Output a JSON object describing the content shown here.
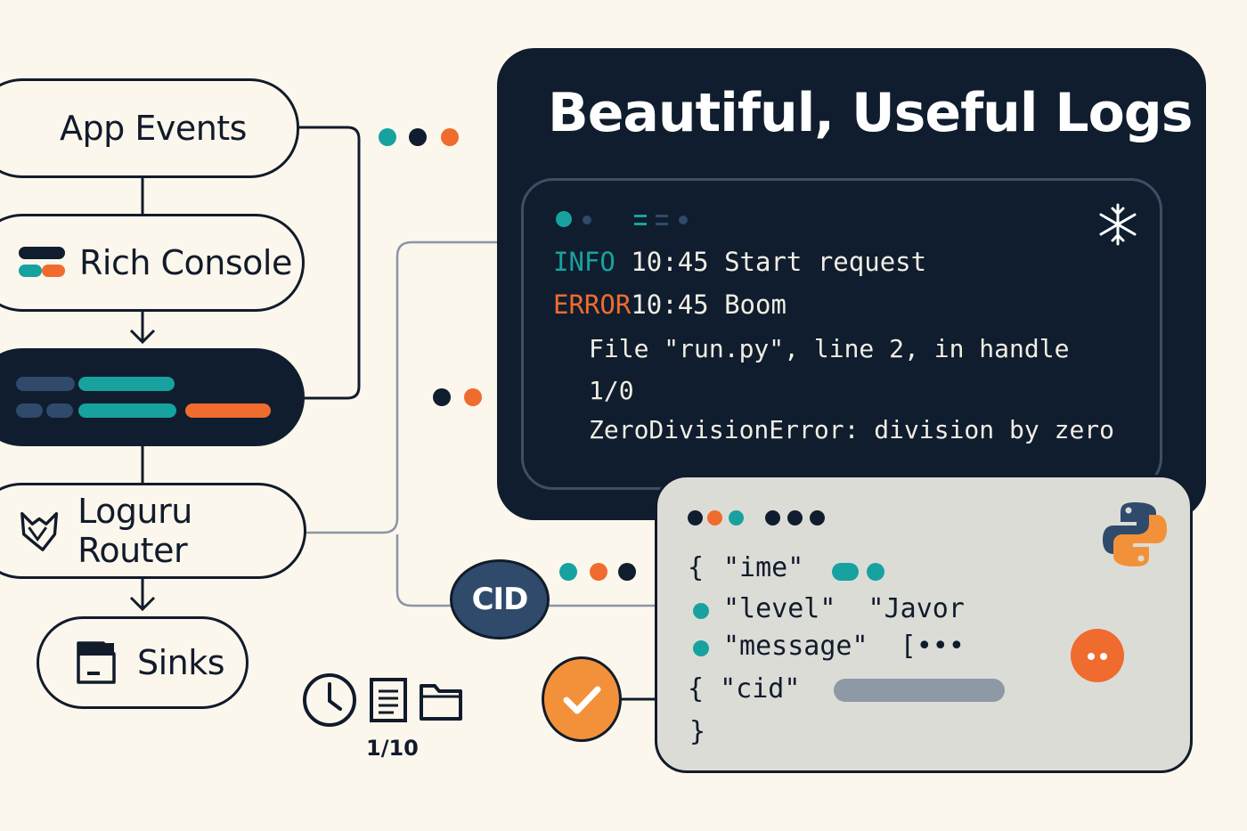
{
  "flow": {
    "app_events": "App Events",
    "rich_console": "Rich Console",
    "loguru_router": "Loguru Router",
    "sinks": "Sinks"
  },
  "panel": {
    "title": "Beautiful, Useful Logs",
    "log_lines": [
      {
        "level": "INFO",
        "time": "10:45",
        "message": "Start request"
      },
      {
        "level": "ERROR",
        "time": "10:45",
        "message": "Boom"
      }
    ],
    "traceback": [
      "File \"run.py\", line 2, in handle",
      "1/0",
      "ZeroDivisionError: division by zero"
    ]
  },
  "json_card": {
    "open_brace": "{",
    "lines": [
      "\"ime\"",
      "\"level\"  \"Javor",
      "\"message\"  [•••",
      "{ \"cid\""
    ],
    "close_brace": "}"
  },
  "cid_badge": "CID",
  "rotation_label": "1/10",
  "colors": {
    "teal": "#17a2a0",
    "orange": "#ef6b2e",
    "navy": "#0f1d2e",
    "slate": "#2f4a6b",
    "badge_orange": "#f3913a"
  },
  "icons": [
    "clock-icon",
    "document-icon",
    "folder-icon",
    "python-logo-icon",
    "check-icon",
    "snowflake-icon",
    "wolf-icon",
    "drive-icon"
  ]
}
